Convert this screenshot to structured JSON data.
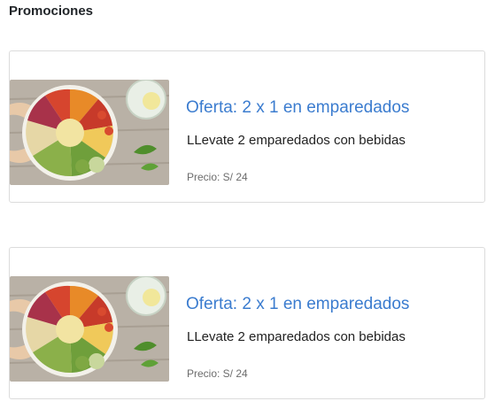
{
  "section": {
    "title": "Promociones"
  },
  "promotions": [
    {
      "title": "Oferta: 2 x 1 en emparedados",
      "description": "LLevate 2 emparedados con bebidas",
      "price": "Precio: S/ 24"
    },
    {
      "title": "Oferta: 2 x 1 en emparedados",
      "description": "LLevate 2 emparedados con bebidas",
      "price": "Precio: S/ 24"
    }
  ]
}
